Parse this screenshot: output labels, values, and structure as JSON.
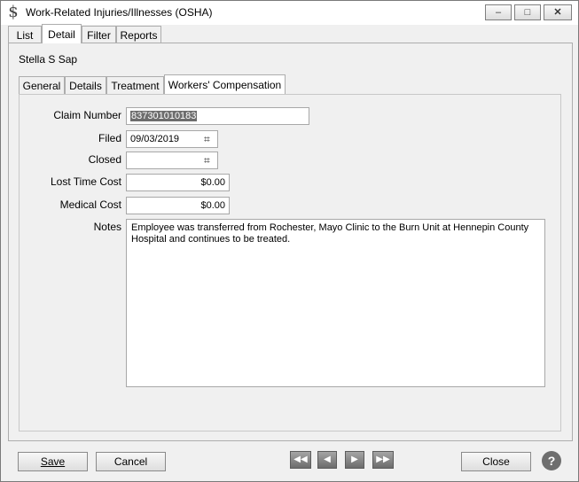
{
  "window": {
    "title": "Work-Related Injuries/Illnesses (OSHA)",
    "app_icon": "dollar-icon",
    "minimize_glyph": "–",
    "maximize_glyph": "□",
    "close_glyph": "✕"
  },
  "main_tabs": [
    "List",
    "Detail",
    "Filter",
    "Reports"
  ],
  "employee_name": "Stella S Sap",
  "sub_tabs": [
    "General",
    "Details",
    "Treatment",
    "Workers' Compensation"
  ],
  "form": {
    "claim_number_label": "Claim Number",
    "claim_number_value": "837301010183",
    "filed_label": "Filed",
    "filed_value": "09/03/2019",
    "closed_label": "Closed",
    "closed_value": "",
    "lost_time_cost_label": "Lost Time Cost",
    "lost_time_cost_value": "$0.00",
    "medical_cost_label": "Medical Cost",
    "medical_cost_value": "$0.00",
    "notes_label": "Notes",
    "notes_value": "Employee was transferred from Rochester, Mayo Clinic to the Burn Unit at Hennepin County Hospital and continues to be treated."
  },
  "buttons": {
    "save": "Save",
    "cancel": "Cancel",
    "close": "Close",
    "help": "?"
  },
  "nav": {
    "first": "◀◀",
    "prev": "◀",
    "next": "▶",
    "last": "▶▶"
  }
}
